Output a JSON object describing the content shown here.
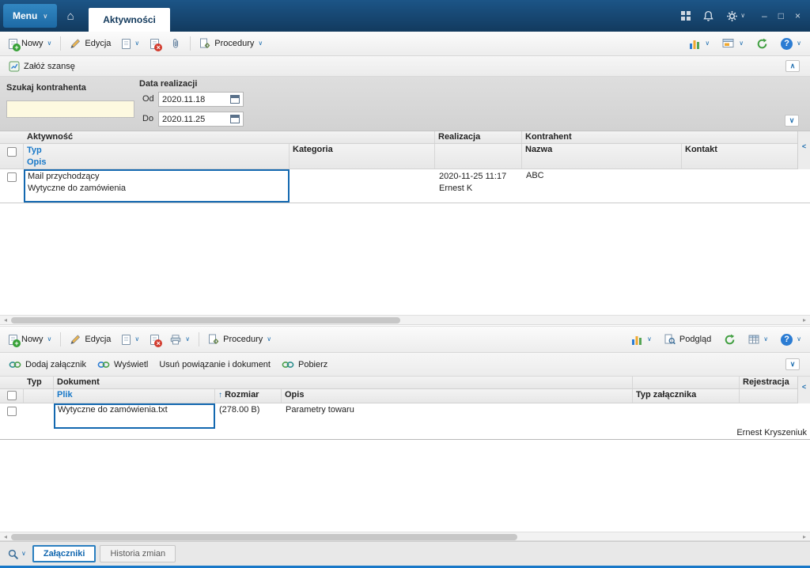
{
  "icons": {
    "chevron_down": "∨",
    "chevron_up": "∧",
    "chevron_left": "<",
    "scroll_left": "◂",
    "scroll_right": "▸",
    "home": "⌂",
    "minimize": "–",
    "maximize": "□",
    "close": "×",
    "question": "?",
    "sort_up": "↑"
  },
  "titlebar": {
    "menu_label": "Menu",
    "tab_label": "Aktywności"
  },
  "toolbar_main": {
    "nowy": "Nowy",
    "edycja": "Edycja",
    "procedury": "Procedury"
  },
  "actions": {
    "zaloz_szanse": "Załóż szansę"
  },
  "filters": {
    "szukaj_label": "Szukaj kontrahenta",
    "szukaj_value": "",
    "data_label": "Data realizacji",
    "od_label": "Od",
    "od_value": "2020.11.18",
    "do_label": "Do",
    "do_value": "2020.11.25"
  },
  "table1": {
    "headers": {
      "aktywnosc": "Aktywność",
      "typ": "Typ",
      "opis": "Opis",
      "kategoria": "Kategoria",
      "realizacja": "Realizacja",
      "kontrahent": "Kontrahent",
      "nazwa": "Nazwa",
      "kontakt": "Kontakt"
    },
    "row": {
      "typ": "Mail przychodzący",
      "opis": "Wytyczne do zamówienia",
      "realizacja_data": "2020-11-25 11:17",
      "realizacja_osoba": "Ernest K",
      "nazwa": "ABC"
    }
  },
  "toolbar_attach": {
    "nowy": "Nowy",
    "edycja": "Edycja",
    "procedury": "Procedury",
    "podglad": "Podgląd"
  },
  "attachment_bar": {
    "dodaj": "Dodaj załącznik",
    "wyswietl": "Wyświetl",
    "usun": "Usuń powiązanie i dokument",
    "pobierz": "Pobierz"
  },
  "table2": {
    "headers": {
      "typ": "Typ",
      "dokument": "Dokument",
      "plik": "Plik",
      "rozmiar": "Rozmiar",
      "opis": "Opis",
      "typ_zalacznika": "Typ załącznika",
      "rejestracja": "Rejestracja"
    },
    "row": {
      "plik": "Wytyczne do zamówienia.txt",
      "rozmiar": "(278.00 B)",
      "opis": "Parametry towaru",
      "rejestracja": "Ernest Kryszeniuk"
    }
  },
  "bottom_tabs": {
    "zalaczniki": "Załączniki",
    "historia": "Historia zmian"
  }
}
